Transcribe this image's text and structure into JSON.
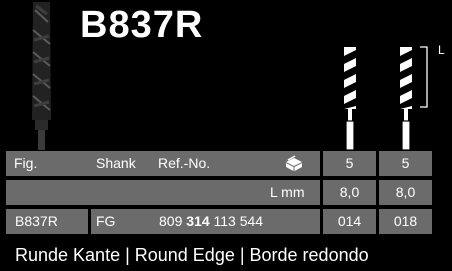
{
  "product": {
    "code": "B837R"
  },
  "table": {
    "fig_label": "Fig.",
    "shank_label": "Shank",
    "refno_label": "Ref.-No.",
    "pack_icon": "package-icon",
    "qty": [
      "5",
      "5"
    ],
    "length_label": "L mm",
    "length": [
      "8,0",
      "8,0"
    ],
    "fig_value": "B837R",
    "shank_value": "FG",
    "ref_prefix": "809",
    "ref_bold": "314",
    "ref_suffix": "113 544",
    "sizes": [
      "014",
      "018"
    ]
  },
  "diagram": {
    "length_label": "L"
  },
  "footer": {
    "text": "Runde Kante | Round Edge | Borde redondo"
  },
  "colors": {
    "background": "#000000",
    "cell": "#6b6b6b",
    "text": "#ffffff"
  }
}
